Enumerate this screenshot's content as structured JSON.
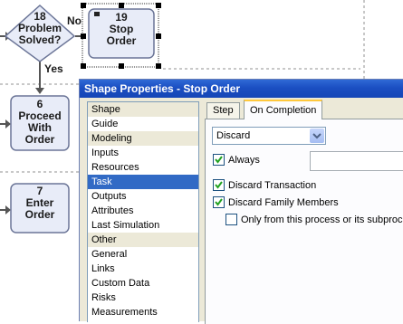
{
  "flowchart": {
    "decision": {
      "number": "18",
      "lines": [
        "Problem",
        "Solved?"
      ]
    },
    "stop": {
      "number": "19",
      "lines": [
        "Stop",
        "Order"
      ]
    },
    "proceed": {
      "number": "6",
      "lines": [
        "Proceed",
        "With",
        "Order"
      ]
    },
    "enter": {
      "number": "7",
      "lines": [
        "Enter",
        "Order"
      ]
    },
    "edge_no": "No",
    "edge_yes": "Yes"
  },
  "dialog": {
    "title": "Shape Properties - Stop Order",
    "nav": [
      {
        "label": "Shape",
        "kind": "header"
      },
      {
        "label": "Guide",
        "kind": "item"
      },
      {
        "label": "Modeling",
        "kind": "header"
      },
      {
        "label": "Inputs",
        "kind": "item"
      },
      {
        "label": "Resources",
        "kind": "item"
      },
      {
        "label": "Task",
        "kind": "selected"
      },
      {
        "label": "Outputs",
        "kind": "item"
      },
      {
        "label": "Attributes",
        "kind": "item"
      },
      {
        "label": "Last Simulation",
        "kind": "item"
      },
      {
        "label": "Other",
        "kind": "header"
      },
      {
        "label": "General",
        "kind": "item"
      },
      {
        "label": "Links",
        "kind": "item"
      },
      {
        "label": "Custom Data",
        "kind": "item"
      },
      {
        "label": "Risks",
        "kind": "item"
      },
      {
        "label": "Measurements",
        "kind": "item"
      }
    ],
    "tabs": [
      "Step",
      "On Completion"
    ],
    "active_tab": "On Completion",
    "dropdown_value": "Discard",
    "always": {
      "label": "Always",
      "checked": true
    },
    "discard_transaction": {
      "label": "Discard Transaction",
      "checked": true
    },
    "discard_family": {
      "label": "Discard Family Members",
      "checked": true
    },
    "only_from_process": {
      "label": "Only from this process or its subproce",
      "checked": false
    }
  },
  "colors": {
    "shape_fill": "#e8ecf8",
    "shape_stroke": "#6b7597",
    "selected_nav": "#316ac5",
    "titlebar": "#1b4ec2",
    "check": "#21a121"
  },
  "icons": {
    "checkmark": "check-icon",
    "dropdown_arrow": "chevron-down-icon",
    "shape_flag": "flag-icon"
  }
}
